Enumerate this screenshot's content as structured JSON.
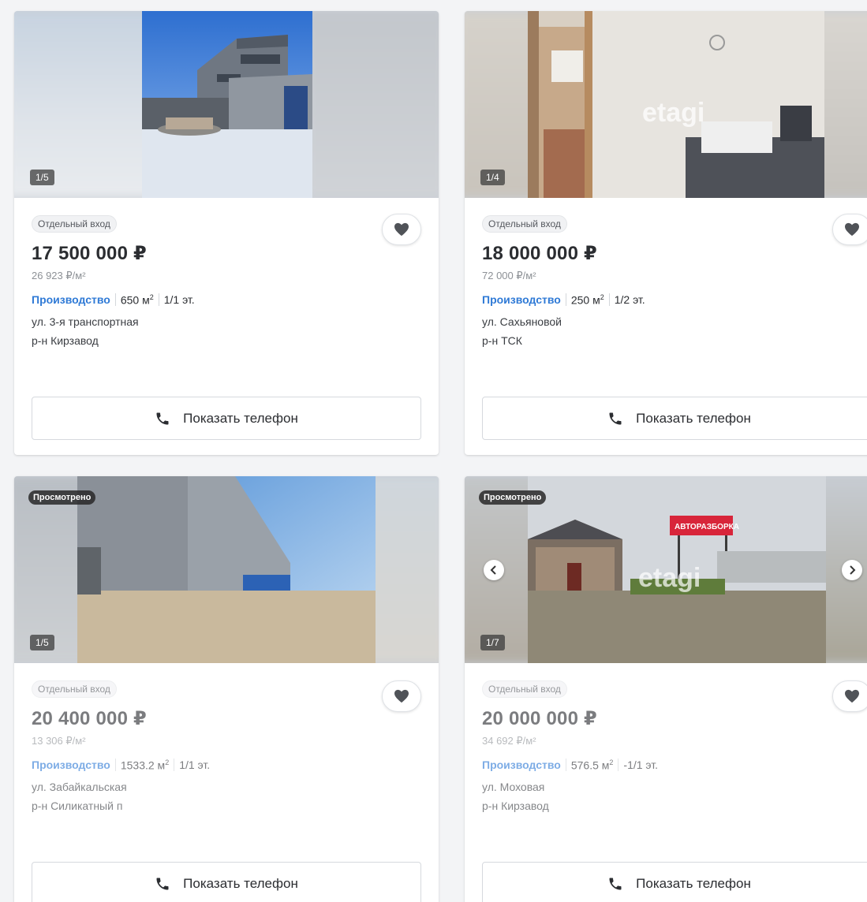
{
  "listings": [
    {
      "badge": "Отдельный вход",
      "price": "17 500 000 ₽",
      "price_per_m2": "26 923 ₽/м²",
      "type": "Производство",
      "area": "650 м",
      "floor": "1/1 эт.",
      "street": "ул. 3-я транспортная",
      "district": "р-н Кирзавод",
      "photo_counter": "1/5",
      "viewed_label": "",
      "phone_button": "Показать телефон"
    },
    {
      "badge": "Отдельный вход",
      "price": "18 000 000 ₽",
      "price_per_m2": "72 000 ₽/м²",
      "type": "Производство",
      "area": "250 м",
      "floor": "1/2 эт.",
      "street": "ул. Сахьяновой",
      "district": "р-н ТСК",
      "photo_counter": "1/4",
      "viewed_label": "",
      "phone_button": "Показать телефон"
    },
    {
      "badge": "Отдельный вход",
      "price": "20 400 000 ₽",
      "price_per_m2": "13 306 ₽/м²",
      "type": "Производство",
      "area": "1533.2 м",
      "floor": "1/1 эт.",
      "street": "ул. Забайкальская",
      "district": "р-н Силикатный п",
      "photo_counter": "1/5",
      "viewed_label": "Просмотрено",
      "phone_button": "Показать телефон"
    },
    {
      "badge": "Отдельный вход",
      "price": "20 000 000 ₽",
      "price_per_m2": "34 692 ₽/м²",
      "type": "Производство",
      "area": "576.5 м",
      "floor": "-1/1 эт.",
      "street": "ул. Моховая",
      "district": "р-н Кирзавод",
      "photo_counter": "1/7",
      "viewed_label": "Просмотрено",
      "phone_button": "Показать телефон"
    }
  ],
  "area_superscript": "2",
  "watermark": "etagi",
  "sign_text": "АВТОРАЗБОРКА",
  "icons": {
    "favorite": "heart-icon",
    "phone": "phone-icon",
    "prev": "chevron-left-icon",
    "next": "chevron-right-icon"
  },
  "colors": {
    "accent_link": "#2f7ad6",
    "text": "#2b2d31",
    "muted": "#8d9196",
    "heart": "#505358"
  }
}
